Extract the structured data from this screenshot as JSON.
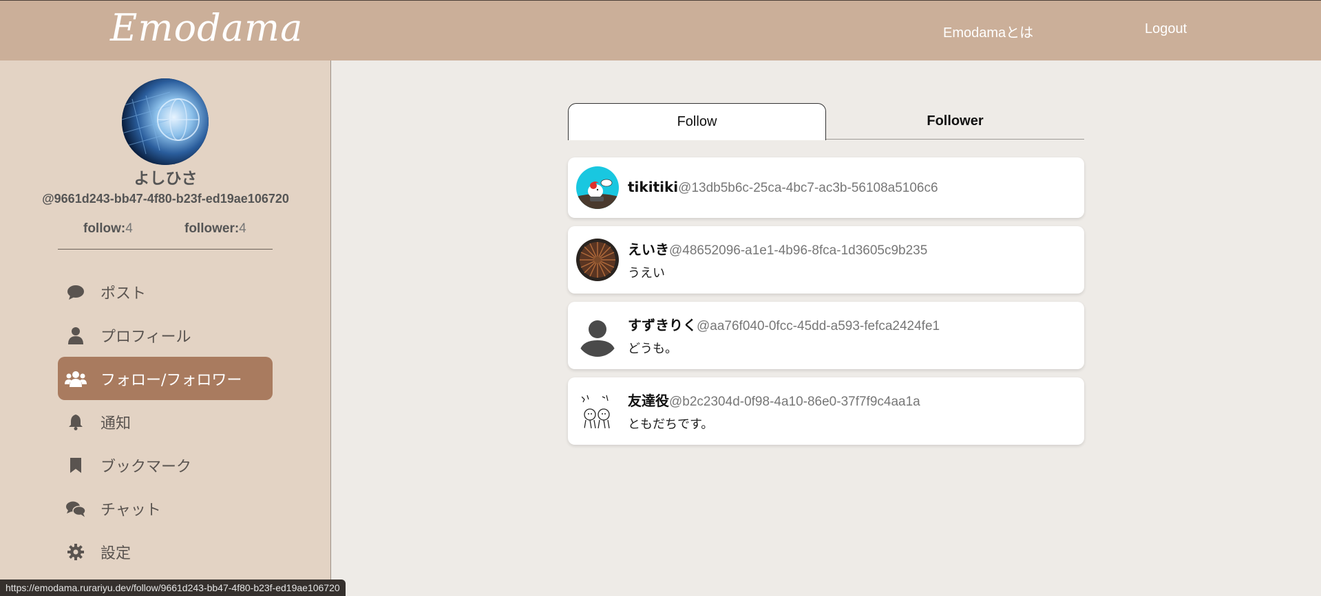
{
  "header": {
    "logo": "Emodama",
    "about_link": "Emodamaとは",
    "logout_link": "Logout",
    "bg_color": "#cbaf99"
  },
  "profile": {
    "name": "よしひさ",
    "id": "@9661d243-bb47-4f80-b23f-ed19ae106720",
    "follow_label": "follow:",
    "follow_count": "4",
    "follower_label": "follower:",
    "follower_count": "4"
  },
  "menu": {
    "items": [
      {
        "label": "ポスト",
        "icon": "comment-icon"
      },
      {
        "label": "プロフィール",
        "icon": "user-icon"
      },
      {
        "label": "フォロー/フォロワー",
        "icon": "users-icon",
        "active": true
      },
      {
        "label": "通知",
        "icon": "bell-icon"
      },
      {
        "label": "ブックマーク",
        "icon": "bookmark-icon"
      },
      {
        "label": "チャット",
        "icon": "chat-icon"
      },
      {
        "label": "設定",
        "icon": "gear-icon"
      }
    ],
    "active_color": "#a97b5f"
  },
  "tabs": {
    "follow": "Follow",
    "follower": "Follower",
    "selected": "Follow"
  },
  "users": [
    {
      "name": "tikitiki",
      "id": "@13db5b6c-25ca-4bc7-ac3b-56108a5106c6",
      "bio": ""
    },
    {
      "name": "えいき",
      "id": "@48652096-a1e1-4b96-8fca-1d3605c9b235",
      "bio": "うえい"
    },
    {
      "name": "すずきりく",
      "id": "@aa76f040-0fcc-45dd-a593-fefca2424fe1",
      "bio": "どうも。"
    },
    {
      "name": "友達役",
      "id": "@b2c2304d-0f98-4a10-86e0-37f7f9c4aa1a",
      "bio": "ともだちです。"
    }
  ],
  "status_url": "https://emodama.rurariyu.dev/follow/9661d243-bb47-4f80-b23f-ed19ae106720"
}
